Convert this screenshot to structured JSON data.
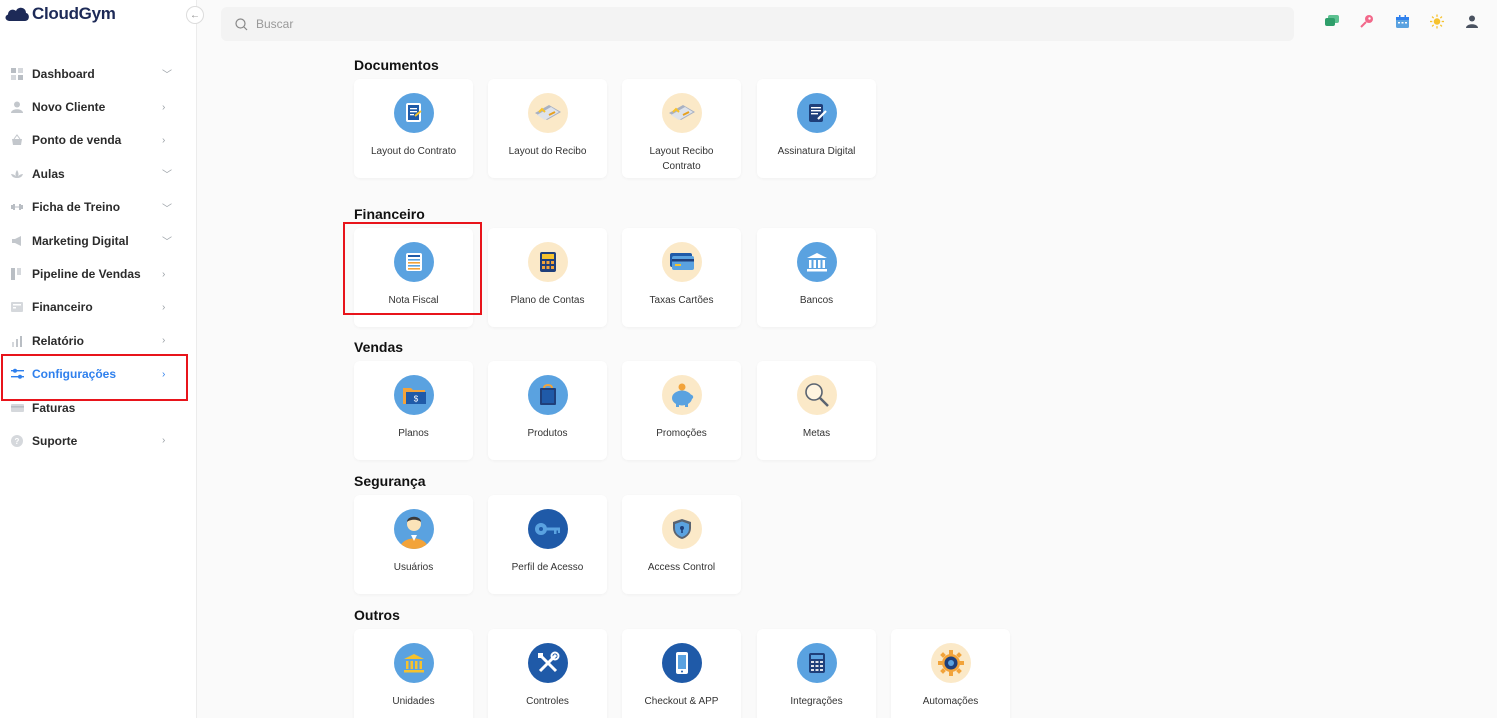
{
  "app": {
    "logo_text": "CloudGym"
  },
  "search": {
    "placeholder": "Buscar"
  },
  "top_icons": [
    "chat-icon",
    "key-icon",
    "calendar-icon",
    "sun-icon",
    "user-icon"
  ],
  "sidebar": {
    "items": [
      {
        "label": "Dashboard",
        "icon": "dashboard-icon",
        "chevron": "down",
        "active": false
      },
      {
        "label": "Novo Cliente",
        "icon": "user-icon",
        "chevron": "right",
        "active": false
      },
      {
        "label": "Ponto de venda",
        "icon": "basket-icon",
        "chevron": "right",
        "active": false
      },
      {
        "label": "Aulas",
        "icon": "lotus-icon",
        "chevron": "down",
        "active": false
      },
      {
        "label": "Ficha de Treino",
        "icon": "dumbbell-icon",
        "chevron": "down",
        "active": false
      },
      {
        "label": "Marketing Digital",
        "icon": "megaphone-icon",
        "chevron": "down",
        "active": false
      },
      {
        "label": "Pipeline de Vendas",
        "icon": "pipeline-icon",
        "chevron": "right",
        "active": false
      },
      {
        "label": "Financeiro",
        "icon": "finance-icon",
        "chevron": "right",
        "active": false
      },
      {
        "label": "Relatório",
        "icon": "bar-chart-icon",
        "chevron": "right",
        "active": false
      },
      {
        "label": "Configurações",
        "icon": "sliders-icon",
        "chevron": "right",
        "active": true
      },
      {
        "label": "Faturas",
        "icon": "card-icon",
        "chevron": "",
        "active": false
      },
      {
        "label": "Suporte",
        "icon": "help-icon",
        "chevron": "right",
        "active": false
      }
    ]
  },
  "sections": [
    {
      "title": "Documentos",
      "cards": [
        {
          "label": "Layout do Contrato",
          "icon": "contract-icon"
        },
        {
          "label": "Layout do Recibo",
          "icon": "receipt-icon"
        },
        {
          "label": "Layout Recibo Contrato",
          "icon": "receipt-contract-icon"
        },
        {
          "label": "Assinatura Digital",
          "icon": "signature-icon"
        }
      ]
    },
    {
      "title": "Financeiro",
      "cards": [
        {
          "label": "Nota Fiscal",
          "icon": "invoice-icon"
        },
        {
          "label": "Plano de Contas",
          "icon": "calculator-icon"
        },
        {
          "label": "Taxas Cartões",
          "icon": "credit-card-icon"
        },
        {
          "label": "Bancos",
          "icon": "bank-icon"
        }
      ]
    },
    {
      "title": "Vendas",
      "cards": [
        {
          "label": "Planos",
          "icon": "plans-folder-icon"
        },
        {
          "label": "Produtos",
          "icon": "products-icon"
        },
        {
          "label": "Promoções",
          "icon": "piggy-bank-icon"
        },
        {
          "label": "Metas",
          "icon": "magnifier-icon"
        }
      ]
    },
    {
      "title": "Segurança",
      "cards": [
        {
          "label": "Usuários",
          "icon": "users-icon"
        },
        {
          "label": "Perfil de Acesso",
          "icon": "access-key-icon"
        },
        {
          "label": "Access Control",
          "icon": "shield-icon"
        }
      ]
    },
    {
      "title": "Outros",
      "cards": [
        {
          "label": "Unidades",
          "icon": "units-building-icon"
        },
        {
          "label": "Controles",
          "icon": "tools-icon"
        },
        {
          "label": "Checkout & APP",
          "icon": "phone-icon"
        },
        {
          "label": "Integrações",
          "icon": "integrations-icon"
        },
        {
          "label": "Automações",
          "icon": "gear-automation-icon"
        }
      ]
    }
  ],
  "colors": {
    "accent": "#2f80ed",
    "highlight": "#e8141b",
    "logo": "#1d2a57"
  }
}
